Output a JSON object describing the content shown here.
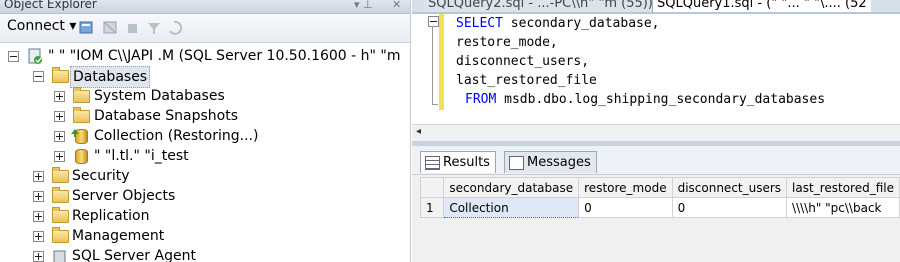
{
  "object_explorer": {
    "title": "Object Explorer",
    "title_icons": [
      "▾ ⊥",
      "✕"
    ],
    "toolbar": {
      "connect_label": "Connect ▾"
    },
    "server": {
      "label": "\" \" \"IOM   C\\\\JAPI .M (SQL Server 10.50.1600 - h\" \"m"
    },
    "tree": [
      {
        "label": "Databases",
        "selected": true
      },
      {
        "label": "System Databases"
      },
      {
        "label": "Database Snapshots"
      },
      {
        "label": "Collection (Restoring...)"
      },
      {
        "label": "\" \"l.tl.\" \"i_test"
      },
      {
        "label": "Security"
      },
      {
        "label": "Server Objects"
      },
      {
        "label": "Replication"
      },
      {
        "label": "Management"
      },
      {
        "label": "SQL Server Agent"
      }
    ]
  },
  "query_window": {
    "tabs": [
      {
        "label": "SQLQuery2.sql - ...-PC\\\\h\" \"m (55))*"
      },
      {
        "label": "SQLQuery1.sql - (\" \"... \" \"\\.... (52"
      }
    ],
    "code_lines": [
      {
        "kw": "SELECT",
        "text": " secondary_database,"
      },
      {
        "kw": "",
        "text": "restore_mode,"
      },
      {
        "kw": "",
        "text": "disconnect_users,"
      },
      {
        "kw": "",
        "text": "last_restored_file"
      },
      {
        "kw": "FROM",
        "text": " msdb.dbo.log_shipping_secondary_databases"
      }
    ],
    "scroll_left_glyph": "◂"
  },
  "results": {
    "tabs": {
      "results_label": "Results",
      "messages_label": "Messages"
    },
    "columns": [
      "secondary_database",
      "restore_mode",
      "disconnect_users",
      "last_restored_file"
    ],
    "rows": [
      {
        "num": "1",
        "cells": [
          "Collection",
          "0",
          "0",
          "\\\\\\\\h\" \"pc\\\\back"
        ]
      }
    ]
  }
}
